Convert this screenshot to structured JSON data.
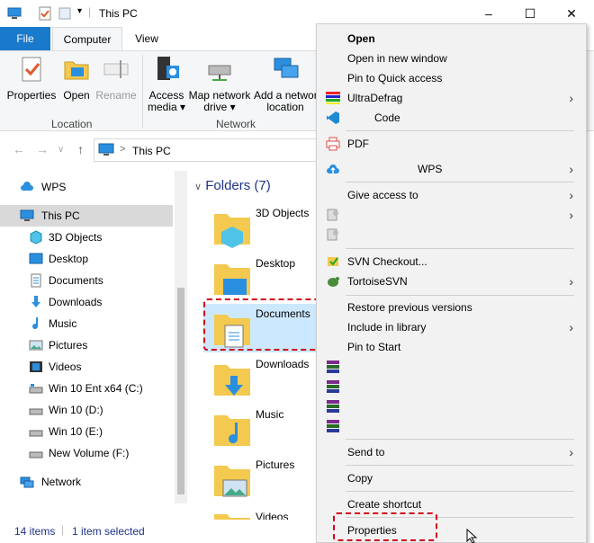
{
  "window": {
    "title": "This PC",
    "controls": [
      "minimize",
      "maximize",
      "close"
    ]
  },
  "ribbon": {
    "tabs": [
      "File",
      "Computer",
      "View"
    ],
    "buttons": {
      "properties": "Properties",
      "open": "Open",
      "rename": "Rename",
      "access_media_1": "Access",
      "access_media_2": "media ▾",
      "map_drive_1": "Map network",
      "map_drive_2": "drive ▾",
      "add_location_1": "Add a network",
      "add_location_2": "location"
    },
    "groups": {
      "location": "Location",
      "network": "Network"
    }
  },
  "address": {
    "path": "This PC",
    "separator": ">"
  },
  "nav": {
    "items": [
      {
        "label": "WPS",
        "icon": "cloud-icon"
      },
      {
        "label": "This PC",
        "icon": "computer-icon"
      },
      {
        "label": "3D Objects",
        "icon": "cube-icon"
      },
      {
        "label": "Desktop",
        "icon": "desktop-icon"
      },
      {
        "label": "Documents",
        "icon": "documents-icon"
      },
      {
        "label": "Downloads",
        "icon": "download-arrow-icon"
      },
      {
        "label": "Music",
        "icon": "music-note-icon"
      },
      {
        "label": "Pictures",
        "icon": "pictures-icon"
      },
      {
        "label": "Videos",
        "icon": "film-icon"
      },
      {
        "label": "Win 10 Ent x64 (C:)",
        "icon": "drive-icon"
      },
      {
        "label": "Win 10 (D:)",
        "icon": "drive-icon"
      },
      {
        "label": "Win 10 (E:)",
        "icon": "drive-icon"
      },
      {
        "label": "New Volume (F:)",
        "icon": "drive-icon"
      },
      {
        "label": "Network",
        "icon": "network-icon"
      }
    ]
  },
  "content": {
    "header": "Folders (7)",
    "folders": [
      "3D Objects",
      "Desktop",
      "Documents",
      "Downloads",
      "Music",
      "Pictures",
      "Videos"
    ],
    "selected": "Documents"
  },
  "status": {
    "items": "14 items",
    "selected": "1 item selected"
  },
  "context_menu": {
    "items": [
      {
        "label": "Open",
        "bold": true
      },
      {
        "label": "Open in new window"
      },
      {
        "label": "Pin to Quick access"
      },
      {
        "label": "UltraDefrag",
        "submenu": true,
        "icon": "ultradefrag-icon"
      },
      {
        "label": "Code",
        "icon": "vscode-icon"
      },
      {
        "label": "PDF",
        "icon": "printer-pdf-icon"
      },
      {
        "label": "WPS",
        "submenu": true,
        "icon": "wps-cloud-icon"
      },
      {
        "label": "Give access to",
        "submenu": true
      },
      {
        "label": "",
        "submenu": true,
        "icon": "share-gear-icon"
      },
      {
        "label": "",
        "icon": "share-gear-icon"
      },
      {
        "label": "SVN Checkout...",
        "icon": "svn-icon"
      },
      {
        "label": "TortoiseSVN",
        "submenu": true,
        "icon": "tortoise-icon"
      },
      {
        "label": "Restore previous versions"
      },
      {
        "label": "Include in library",
        "submenu": true
      },
      {
        "label": "Pin to Start"
      },
      {
        "label": "",
        "icon": "winrar-icon"
      },
      {
        "label": "",
        "icon": "winrar-icon"
      },
      {
        "label": "",
        "icon": "winrar-icon"
      },
      {
        "label": "",
        "icon": "winrar-icon"
      },
      {
        "label": "Send to",
        "submenu": true
      },
      {
        "label": "Copy"
      },
      {
        "label": "Create shortcut"
      },
      {
        "label": "Properties"
      }
    ]
  },
  "colors": {
    "accent": "#1979ca",
    "highlight": "#d0021b",
    "selection": "#cce8ff",
    "folder": "#f3c94f"
  }
}
